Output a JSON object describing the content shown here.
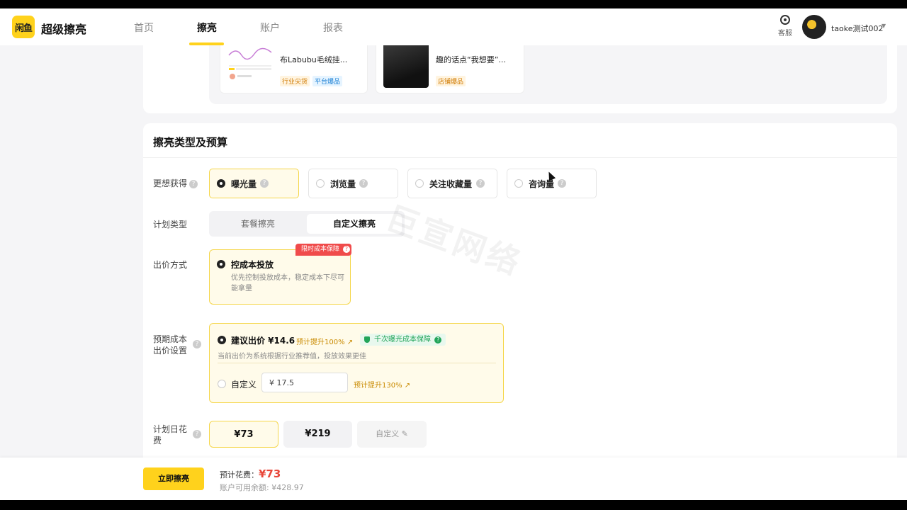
{
  "brand": {
    "logo_text": "闲鱼",
    "name": "超级擦亮"
  },
  "nav": {
    "items": [
      "首页",
      "擦亮",
      "账户",
      "报表"
    ],
    "active": 1
  },
  "header": {
    "service_label": "客服",
    "username": "taoke测试002"
  },
  "cases": [
    {
      "title": "布Labubu毛绒挂...",
      "tags": [
        "行业尖货",
        "平台爆品"
      ]
    },
    {
      "title": "趣的话点“我想要”...",
      "tags": [
        "店铺爆品"
      ]
    }
  ],
  "section": {
    "title": "擦亮类型及预算"
  },
  "goal": {
    "label": "更想获得",
    "options": [
      "曝光量",
      "浏览量",
      "关注收藏量",
      "咨询量"
    ],
    "selected": 0
  },
  "plan_type": {
    "label": "计划类型",
    "options": [
      "套餐擦亮",
      "自定义擦亮"
    ],
    "selected": 1
  },
  "bid_method": {
    "label": "出价方式",
    "badge": "限时成本保障",
    "title": "控成本投放",
    "desc": "优先控制投放成本，稳定成本下尽可能拿量"
  },
  "expected_cost": {
    "label_line1": "预期成本",
    "label_line2": "出价设置",
    "suggest_label": "建议出价 ¥14.6",
    "suggest_up": "预计提升100%",
    "guarantee": "千次曝光成本保障",
    "hint": "当前出价为系统根据行业推荐值，投放效果更佳",
    "custom_label": "自定义",
    "custom_value": "¥ 17.5",
    "custom_up": "预计提升130%"
  },
  "daily_budget": {
    "label_line1": "计划日花",
    "label_line2": "费",
    "options": [
      "¥73",
      "¥219",
      "自定义 ✎"
    ],
    "selected": 0
  },
  "footer": {
    "cta": "立即擦亮",
    "est_label": "预计花费：",
    "est_value": "¥73",
    "balance": "账户可用余额: ¥428.97"
  },
  "watermark": "巨宣网络",
  "colors": {
    "accent": "#ffd21c",
    "danger": "#f04b4b",
    "success": "#22a55a",
    "price": "#e8473a"
  }
}
